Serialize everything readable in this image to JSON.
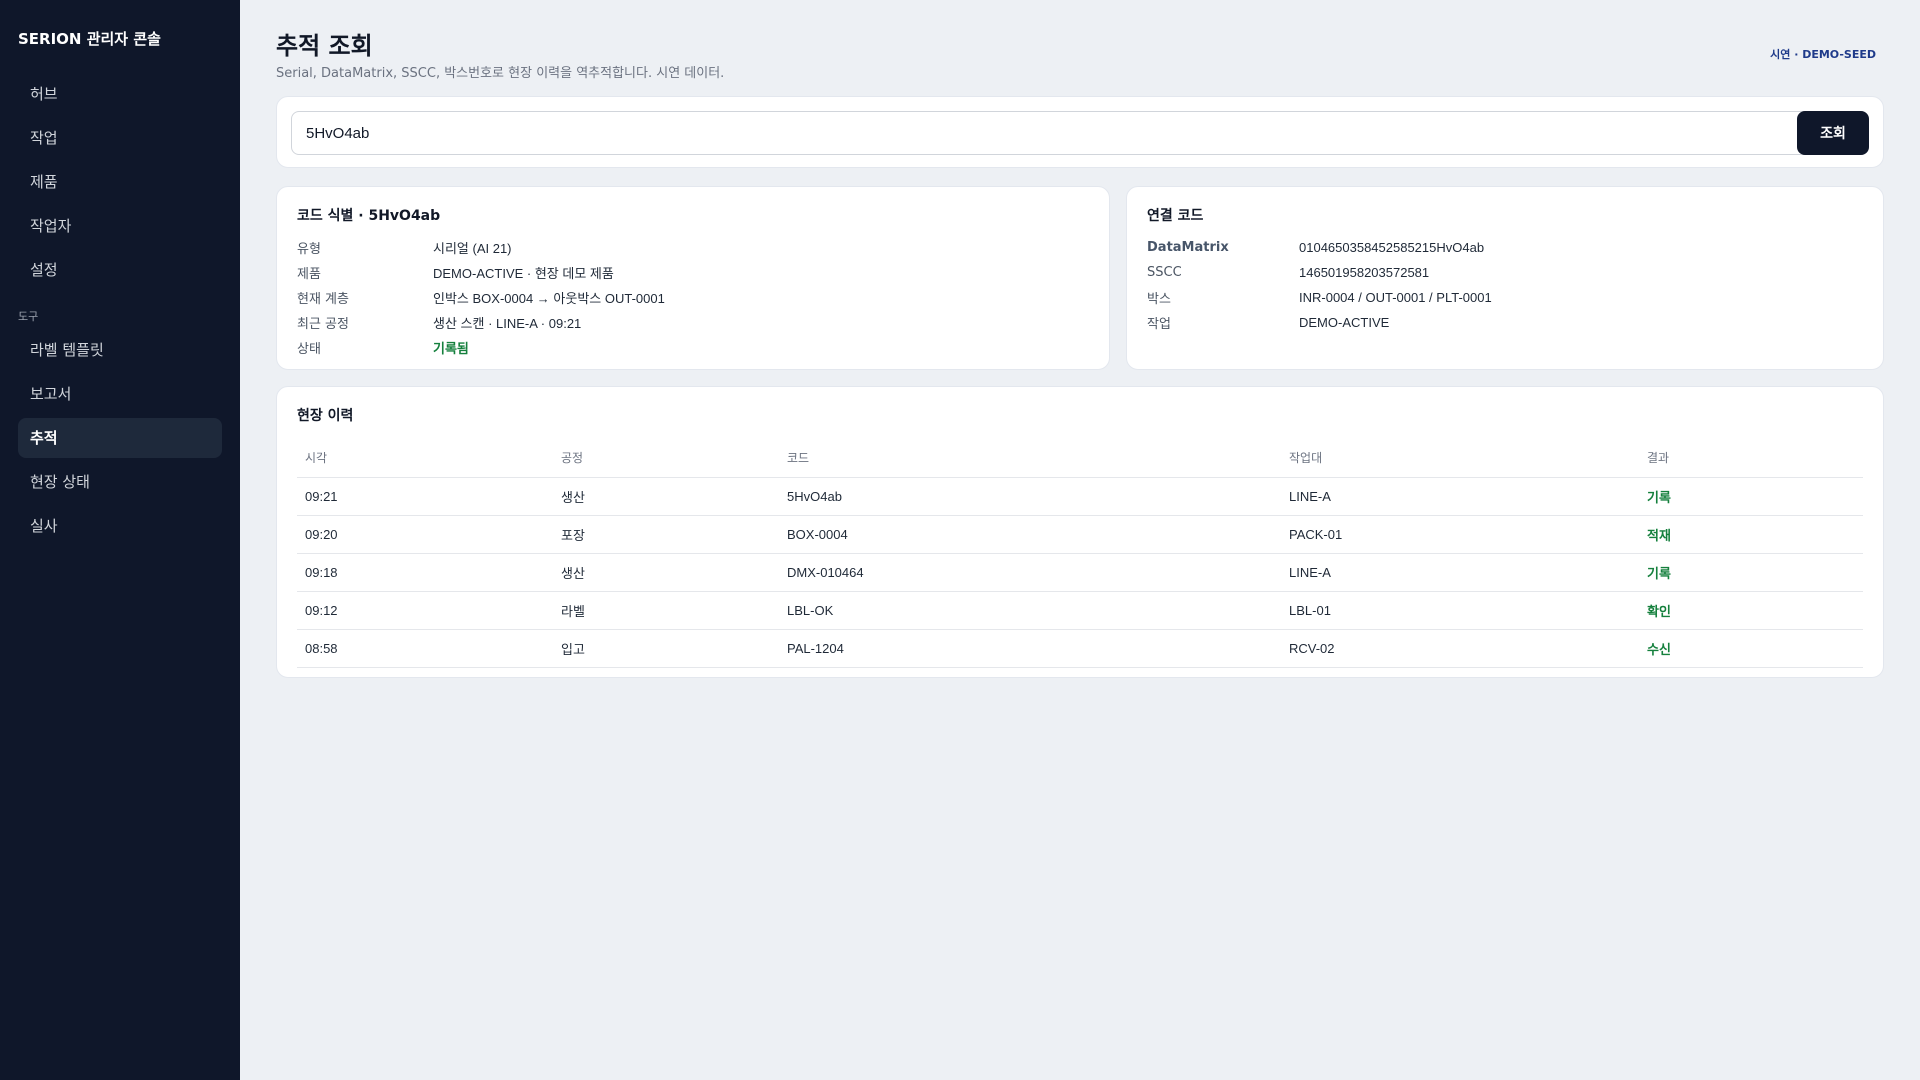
{
  "sidebar": {
    "brand": "SERION 관리자 콘솔",
    "items": [
      {
        "label": "허브"
      },
      {
        "label": "작업"
      },
      {
        "label": "제품"
      },
      {
        "label": "작업자"
      },
      {
        "label": "설정"
      }
    ],
    "section_label": "도구",
    "tool_items": [
      {
        "label": "라벨 템플릿"
      },
      {
        "label": "보고서"
      },
      {
        "label": "추적",
        "active": true
      },
      {
        "label": "현장 상태"
      },
      {
        "label": "실사"
      }
    ]
  },
  "header": {
    "title": "추적 조회",
    "subtitle": "Serial, DataMatrix, SSCC, 박스번호로 현장 이력을 역추적합니다. 시연 데이터.",
    "mode_tag": "시연 · DEMO-SEED"
  },
  "search": {
    "value": "5HvO4ab",
    "button_label": "조회"
  },
  "code_card": {
    "title": "코드 식별 · 5HvO4ab",
    "rows": [
      {
        "key": "유형",
        "value": "시리얼 (AI 21)"
      },
      {
        "key": "제품",
        "value": "DEMO-ACTIVE · 현장 데모 제품"
      },
      {
        "key": "현재 계층",
        "value": "인박스 BOX-0004 → 아웃박스 OUT-0001"
      },
      {
        "key": "최근 공정",
        "value": "생산 스캔 · LINE-A · 09:21"
      },
      {
        "key": "상태",
        "value": "기록됨"
      }
    ]
  },
  "linked_card": {
    "title": "연결 코드",
    "rows": [
      {
        "key": "DataMatrix",
        "value": "0104650358452585215HvO4ab"
      },
      {
        "key": "SSCC",
        "value": "146501958203572581"
      },
      {
        "key": "박스",
        "value": "INR-0004 / OUT-0001 / PLT-0001"
      },
      {
        "key": "작업",
        "value": "DEMO-ACTIVE"
      }
    ]
  },
  "history": {
    "title": "현장 이력",
    "columns": [
      "시각",
      "공정",
      "코드",
      "작업대",
      "결과"
    ],
    "rows": [
      {
        "time": "09:21",
        "process": "생산",
        "code": "5HvO4ab",
        "station": "LINE-A",
        "result": "기록"
      },
      {
        "time": "09:20",
        "process": "포장",
        "code": "BOX-0004",
        "station": "PACK-01",
        "result": "적재"
      },
      {
        "time": "09:18",
        "process": "생산",
        "code": "DMX-010464",
        "station": "LINE-A",
        "result": "기록"
      },
      {
        "time": "09:12",
        "process": "라벨",
        "code": "LBL-OK",
        "station": "LBL-01",
        "result": "확인"
      },
      {
        "time": "08:58",
        "process": "입고",
        "code": "PAL-1204",
        "station": "RCV-02",
        "result": "수신"
      }
    ]
  },
  "colors": {
    "sidebar_bg": "#0f172a",
    "page_bg": "#edf0f4",
    "success": "#15803d",
    "primary_button": "#0f172a"
  }
}
